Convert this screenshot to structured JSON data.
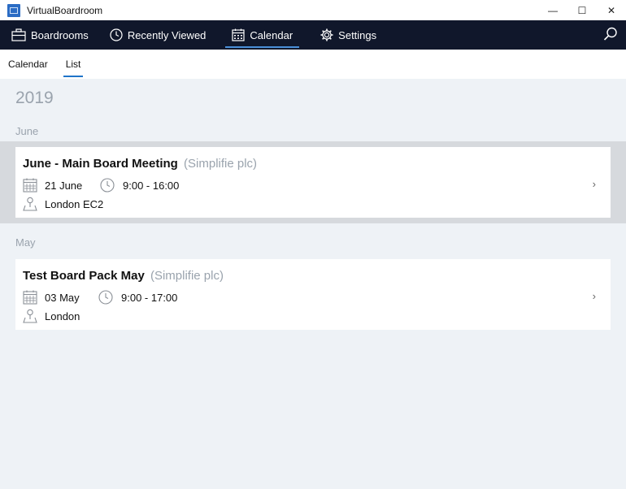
{
  "window": {
    "title": "VirtualBoardroom",
    "minimize": "—",
    "maximize": "☐",
    "close": "✕"
  },
  "nav": {
    "items": [
      {
        "label": "Boardrooms",
        "icon": "briefcase-icon"
      },
      {
        "label": "Recently Viewed",
        "icon": "clock-icon"
      },
      {
        "label": "Calendar",
        "icon": "calendar-icon",
        "active": true
      },
      {
        "label": "Settings",
        "icon": "gear-icon"
      }
    ],
    "search_icon": "search-icon"
  },
  "subtabs": {
    "calendar": "Calendar",
    "list": "List",
    "active": "List"
  },
  "list": {
    "year": "2019",
    "groups": [
      {
        "month": "June",
        "event": {
          "title": "June - Main Board Meeting",
          "org": "(Simplifie plc)",
          "date": "21 June",
          "time": "9:00 - 16:00",
          "location": "London EC2"
        }
      },
      {
        "month": "May",
        "event": {
          "title": "Test Board Pack May",
          "org": "(Simplifie plc)",
          "date": "03 May",
          "time": "9:00 - 17:00",
          "location": "London"
        }
      }
    ]
  },
  "colors": {
    "nav_bg": "#10172b",
    "accent": "#1f74c9",
    "page_bg": "#eef2f6",
    "selected_band": "#d6d9dd",
    "muted_text": "#9aa3ad"
  }
}
